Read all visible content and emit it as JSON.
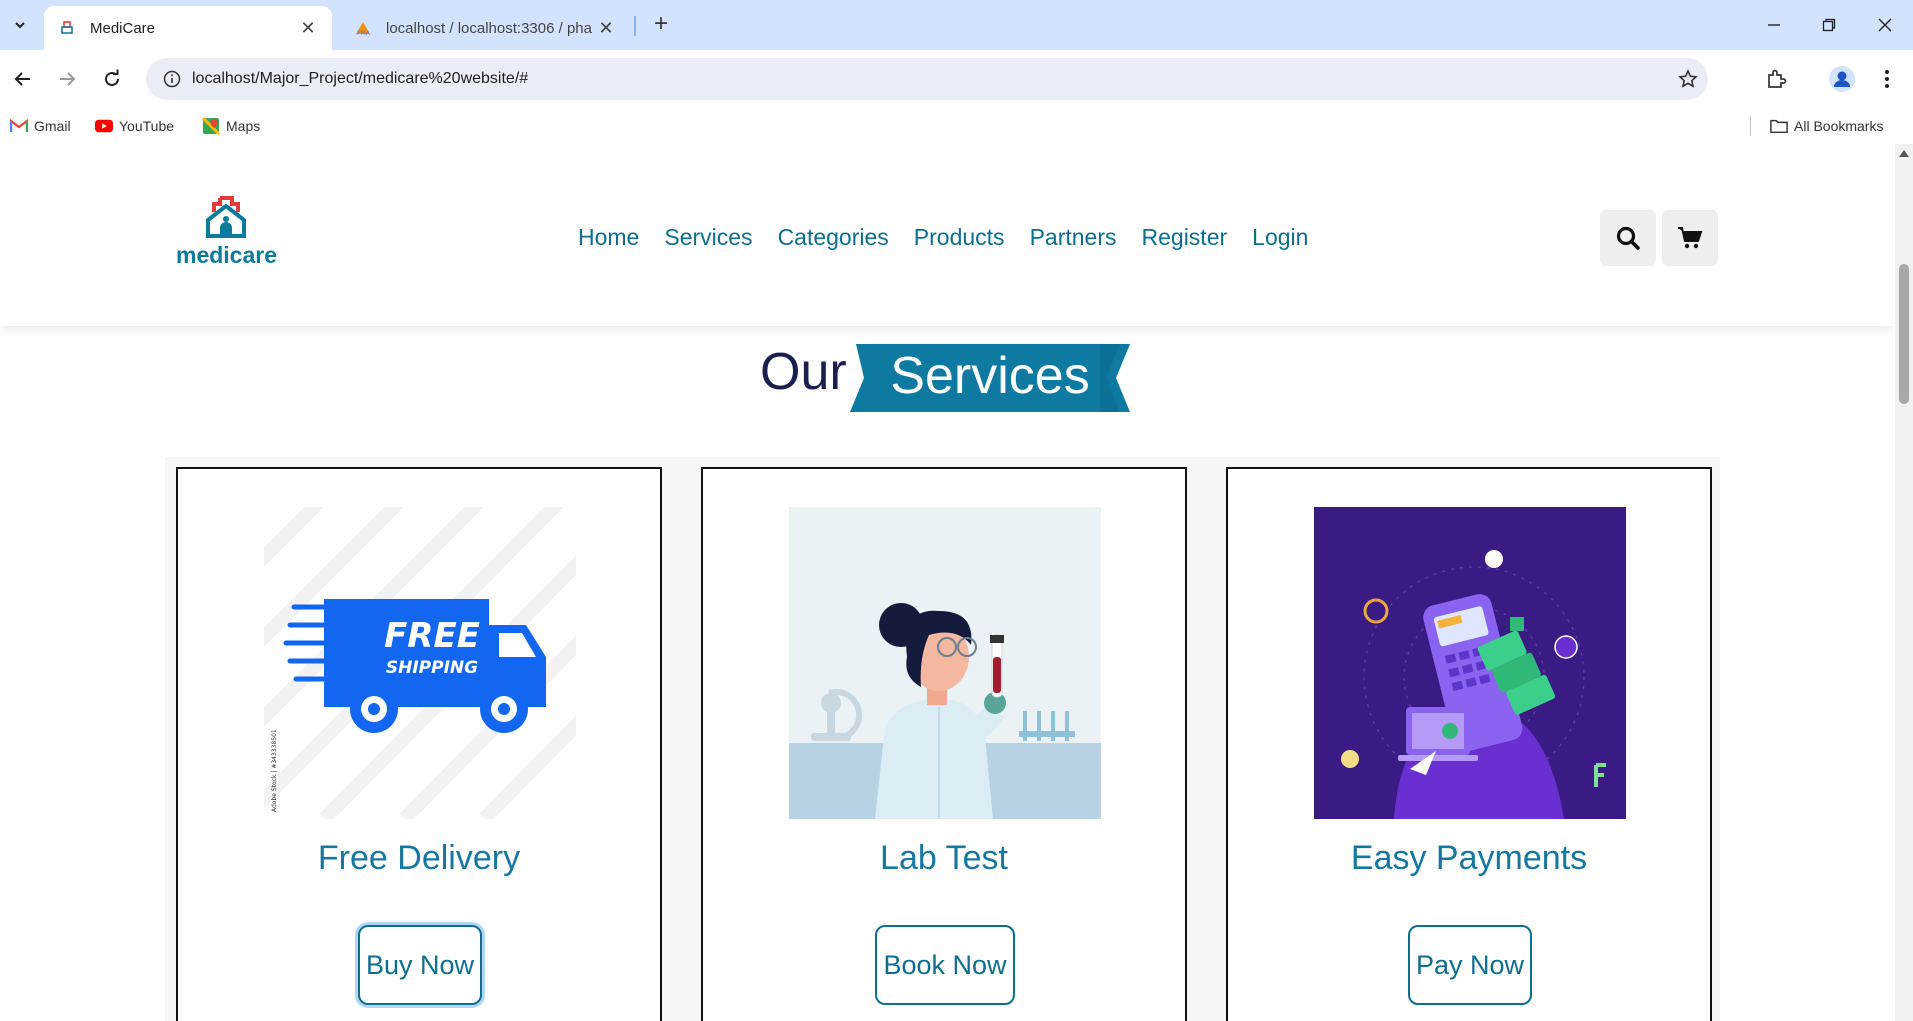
{
  "browser": {
    "tabs": [
      {
        "title": "MediCare",
        "active": true
      },
      {
        "title": "localhost / localhost:3306 / pha",
        "active": false
      }
    ],
    "address": "localhost/Major_Project/medicare%20website/#",
    "bookmarks": [
      {
        "label": "Gmail",
        "icon": "gmail-icon"
      },
      {
        "label": "YouTube",
        "icon": "youtube-icon"
      },
      {
        "label": "Maps",
        "icon": "maps-icon"
      }
    ],
    "all_bookmarks": "All Bookmarks"
  },
  "site": {
    "logo_text": "medicare",
    "nav": [
      "Home",
      "Services",
      "Categories",
      "Products",
      "Partners",
      "Register",
      "Login"
    ],
    "heading": {
      "part1": "Our",
      "part2": "Services"
    },
    "services": [
      {
        "title": "Free Delivery",
        "button": "Buy Now",
        "image_text_1": "FREE",
        "image_text_2": "SHIPPING",
        "image_text_3": "Adobe Stock | #343338501"
      },
      {
        "title": "Lab Test",
        "button": "Book Now"
      },
      {
        "title": "Easy Payments",
        "button": "Pay Now"
      }
    ]
  },
  "colors": {
    "brand_teal": "#0d6e8f",
    "ribbon": "#0e7aa2",
    "heading_dark": "#1a1f4f",
    "tab_strip": "#d3e3fd"
  }
}
